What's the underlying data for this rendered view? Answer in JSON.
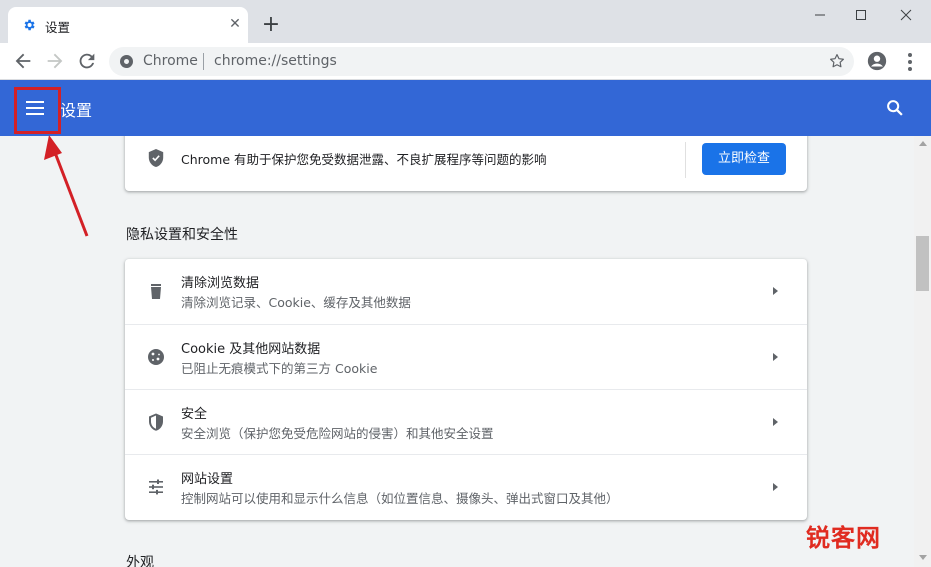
{
  "tab": {
    "title": "设置",
    "close_icon": "close-icon",
    "newtab_label": "+"
  },
  "window": {
    "controls": [
      "minimize-icon",
      "maximize-icon",
      "close-icon"
    ]
  },
  "toolbar": {
    "site_label": "Chrome",
    "url": "chrome://settings"
  },
  "header": {
    "title": "设置",
    "accent": "#3367d6"
  },
  "safety_card": {
    "text": "Chrome 有助于保护您免受数据泄露、不良扩展程序等问题的影响",
    "button_label": "立即检查",
    "button_color": "#1a73e8"
  },
  "privacy_section": {
    "title": "隐私设置和安全性",
    "items": [
      {
        "title": "清除浏览数据",
        "subtitle": "清除浏览记录、Cookie、缓存及其他数据",
        "icon": "trash-icon"
      },
      {
        "title": "Cookie 及其他网站数据",
        "subtitle": "已阻止无痕模式下的第三方 Cookie",
        "icon": "cookie-icon"
      },
      {
        "title": "安全",
        "subtitle": "安全浏览（保护您免受危险网站的侵害）和其他安全设置",
        "icon": "shield-icon"
      },
      {
        "title": "网站设置",
        "subtitle": "控制网站可以使用和显示什么信息（如位置信息、摄像头、弹出式窗口及其他）",
        "icon": "tune-icon"
      }
    ]
  },
  "appearance_section": {
    "title": "外观"
  },
  "annotation": {
    "highlight_color": "#d32026"
  },
  "watermark": {
    "text": "锐客网"
  }
}
